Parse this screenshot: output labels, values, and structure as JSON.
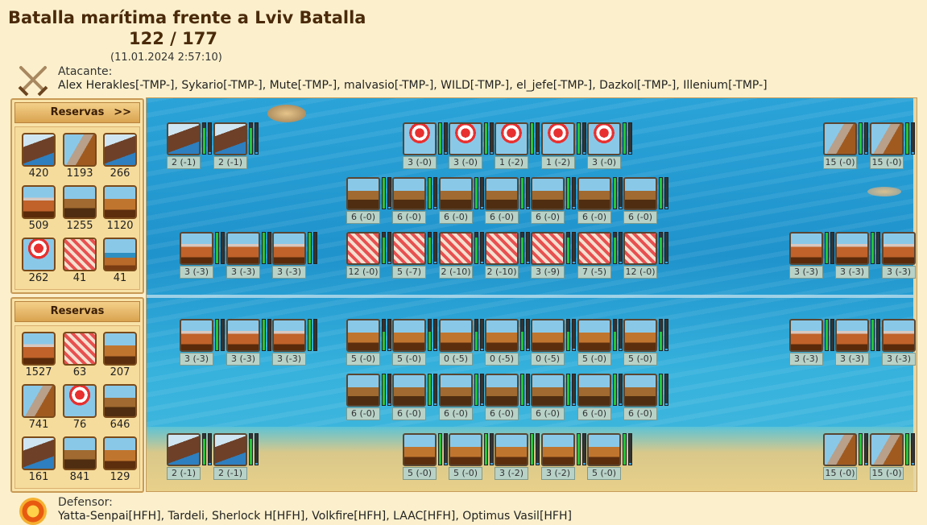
{
  "header": {
    "title": "Batalla marítima frente a Lviv Batalla",
    "round": "122 / 177",
    "datetime": "(11.01.2024 2:57:10)"
  },
  "attacker": {
    "label": "Atacante:",
    "names": "Alex Herakles[-TMP-], Sykario[-TMP-], Mute[-TMP-], malvasio[-TMP-], WILD[-TMP-], el_jefe[-TMP-], Dazkol[-TMP-], Illenium[-TMP-]",
    "icon": "crossed-swords-icon"
  },
  "defender": {
    "label": "Defensor:",
    "names": "Yatta-Senpai[HFH], Tardeli, Sherlock H[HFH], Volkfire[HFH], LAAC[HFH], Optimus Vasil[HFH]",
    "icon": "shield-emblem-icon"
  },
  "reserve_top": {
    "title": "Reservas",
    "more": ">>",
    "items": [
      {
        "type": "steam",
        "count": "420"
      },
      {
        "type": "ballista",
        "count": "1193"
      },
      {
        "type": "steam",
        "count": "266"
      },
      {
        "type": "flame",
        "count": "509"
      },
      {
        "type": "paddle",
        "count": "1255"
      },
      {
        "type": "catapult",
        "count": "1120"
      },
      {
        "type": "mortar",
        "count": "262"
      },
      {
        "type": "rocket",
        "count": "41"
      },
      {
        "type": "ship",
        "count": "41"
      }
    ]
  },
  "reserve_bottom": {
    "title": "Reservas",
    "items": [
      {
        "type": "flame",
        "count": "1527"
      },
      {
        "type": "rocket",
        "count": "63"
      },
      {
        "type": "catapult",
        "count": "207"
      },
      {
        "type": "ballista",
        "count": "741"
      },
      {
        "type": "mortar",
        "count": "76"
      },
      {
        "type": "paddle",
        "count": "646"
      },
      {
        "type": "steam",
        "count": "161"
      },
      {
        "type": "paddle",
        "count": "841"
      },
      {
        "type": "catapult",
        "count": "129"
      }
    ]
  },
  "battlefield": {
    "rows": [
      {
        "units": [
          {
            "type": "steam",
            "label": "2 (-1)",
            "hp": 0.85,
            "am": 0.05
          },
          {
            "type": "steam",
            "label": "2 (-1)",
            "hp": 0.85,
            "am": 0.05
          },
          {
            "type": "mortar",
            "label": "3 (-0)",
            "hp": 1,
            "am": 0.05
          },
          {
            "type": "mortar",
            "label": "3 (-0)",
            "hp": 1,
            "am": 0.05
          },
          {
            "type": "mortar",
            "label": "1 (-2)",
            "hp": 1,
            "am": 0.05
          },
          {
            "type": "mortar",
            "label": "1 (-2)",
            "hp": 1,
            "am": 0.05
          },
          {
            "type": "mortar",
            "label": "3 (-0)",
            "hp": 1,
            "am": 0.05
          },
          {
            "type": "ballista",
            "label": "15 (-0)",
            "hp": 1,
            "am": 0.05
          },
          {
            "type": "ballista",
            "label": "15 (-0)",
            "hp": 1,
            "am": 0.05
          }
        ]
      },
      {
        "units": [
          {
            "type": "paddle",
            "label": "6 (-0)",
            "hp": 1,
            "am": 0.05
          },
          {
            "type": "paddle",
            "label": "6 (-0)",
            "hp": 1,
            "am": 0.05
          },
          {
            "type": "paddle",
            "label": "6 (-0)",
            "hp": 1,
            "am": 0.05
          },
          {
            "type": "paddle",
            "label": "6 (-0)",
            "hp": 1,
            "am": 0.05
          },
          {
            "type": "paddle",
            "label": "6 (-0)",
            "hp": 1,
            "am": 0.05
          },
          {
            "type": "paddle",
            "label": "6 (-0)",
            "hp": 1,
            "am": 0.05
          },
          {
            "type": "paddle",
            "label": "6 (-0)",
            "hp": 1,
            "am": 0.05
          }
        ]
      },
      {
        "units": [
          {
            "type": "flame",
            "label": "3 (-3)",
            "hp": 1,
            "am": 0
          },
          {
            "type": "flame",
            "label": "3 (-3)",
            "hp": 1,
            "am": 0
          },
          {
            "type": "flame",
            "label": "3 (-3)",
            "hp": 1,
            "am": 0
          },
          {
            "type": "rocket",
            "label": "12 (-0)",
            "hp": 0.85,
            "am": 0.05
          },
          {
            "type": "rocket",
            "label": "5 (-7)",
            "hp": 0.85,
            "am": 0.05
          },
          {
            "type": "rocket",
            "label": "2 (-10)",
            "hp": 0.85,
            "am": 0.05
          },
          {
            "type": "rocket",
            "label": "2 (-10)",
            "hp": 0.85,
            "am": 0.05
          },
          {
            "type": "rocket",
            "label": "3 (-9)",
            "hp": 0.85,
            "am": 0.05
          },
          {
            "type": "rocket",
            "label": "7 (-5)",
            "hp": 0.85,
            "am": 0.05
          },
          {
            "type": "rocket",
            "label": "12 (-0)",
            "hp": 0.85,
            "am": 0.05
          },
          {
            "type": "flame",
            "label": "3 (-3)",
            "hp": 1,
            "am": 0
          },
          {
            "type": "flame",
            "label": "3 (-3)",
            "hp": 1,
            "am": 0
          },
          {
            "type": "flame",
            "label": "3 (-3)",
            "hp": 1,
            "am": 0
          }
        ]
      },
      {
        "units": [
          {
            "type": "flame",
            "label": "3 (-3)",
            "hp": 1,
            "am": 0
          },
          {
            "type": "flame",
            "label": "3 (-3)",
            "hp": 1,
            "am": 0
          },
          {
            "type": "flame",
            "label": "3 (-3)",
            "hp": 1,
            "am": 0
          },
          {
            "type": "catapult",
            "label": "5 (-0)",
            "hp": 0.6,
            "am": 0.05
          },
          {
            "type": "catapult",
            "label": "5 (-0)",
            "hp": 0.6,
            "am": 0.05
          },
          {
            "type": "catapult",
            "label": "0 (-5)",
            "hp": 0.6,
            "am": 0.05
          },
          {
            "type": "catapult",
            "label": "0 (-5)",
            "hp": 0.6,
            "am": 0.05
          },
          {
            "type": "catapult",
            "label": "0 (-5)",
            "hp": 0.6,
            "am": 0.05
          },
          {
            "type": "catapult",
            "label": "5 (-0)",
            "hp": 0.6,
            "am": 0.05
          },
          {
            "type": "catapult",
            "label": "5 (-0)",
            "hp": 0.6,
            "am": 0.05
          },
          {
            "type": "flame",
            "label": "3 (-3)",
            "hp": 1,
            "am": 0
          },
          {
            "type": "flame",
            "label": "3 (-3)",
            "hp": 1,
            "am": 0
          },
          {
            "type": "flame",
            "label": "3 (-3)",
            "hp": 1,
            "am": 0
          }
        ]
      },
      {
        "units": [
          {
            "type": "paddle",
            "label": "6 (-0)",
            "hp": 1,
            "am": 0.05
          },
          {
            "type": "paddle",
            "label": "6 (-0)",
            "hp": 1,
            "am": 0.05
          },
          {
            "type": "paddle",
            "label": "6 (-0)",
            "hp": 1,
            "am": 0.05
          },
          {
            "type": "paddle",
            "label": "6 (-0)",
            "hp": 1,
            "am": 0.05
          },
          {
            "type": "paddle",
            "label": "6 (-0)",
            "hp": 1,
            "am": 0.05
          },
          {
            "type": "paddle",
            "label": "6 (-0)",
            "hp": 1,
            "am": 0.05
          },
          {
            "type": "paddle",
            "label": "6 (-0)",
            "hp": 1,
            "am": 0.05
          }
        ]
      },
      {
        "units": [
          {
            "type": "steam",
            "label": "2 (-1)",
            "hp": 0.85,
            "am": 0.05
          },
          {
            "type": "steam",
            "label": "2 (-1)",
            "hp": 0.85,
            "am": 0.05
          },
          {
            "type": "catapult",
            "label": "5 (-0)",
            "hp": 1,
            "am": 0.05
          },
          {
            "type": "catapult",
            "label": "5 (-0)",
            "hp": 1,
            "am": 0.05
          },
          {
            "type": "catapult",
            "label": "3 (-2)",
            "hp": 1,
            "am": 0.05
          },
          {
            "type": "catapult",
            "label": "3 (-2)",
            "hp": 1,
            "am": 0.05
          },
          {
            "type": "catapult",
            "label": "5 (-0)",
            "hp": 1,
            "am": 0.05
          },
          {
            "type": "ballista",
            "label": "15 (-0)",
            "hp": 1,
            "am": 0.05
          },
          {
            "type": "ballista",
            "label": "15 (-0)",
            "hp": 1,
            "am": 0.05
          }
        ]
      }
    ]
  }
}
